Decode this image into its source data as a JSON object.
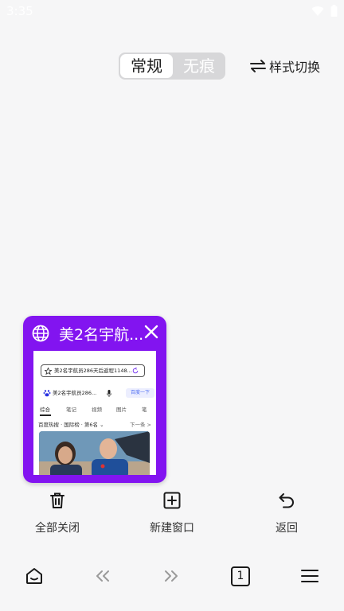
{
  "status_bar": {
    "time": "3:35"
  },
  "mode_switch": {
    "normal_label": "常规",
    "incognito_label": "无痕"
  },
  "style_switch": {
    "label": "样式切换"
  },
  "tab_card": {
    "title": "美2名宇航...",
    "accent_color": "#8214f0",
    "preview": {
      "search_box_text": "美2名宇航员286天后返程1148...",
      "query_text": "美2名宇航员286...",
      "search_button": "百度一下",
      "tabs": [
        "综合",
        "笔记",
        "视频",
        "图片",
        "笔"
      ],
      "more": "下一条 >",
      "hot_text": "百度热搜 · 国际榜 · 第6名 ⌄"
    }
  },
  "actions": [
    {
      "label": "全部关闭",
      "icon": "trash-icon"
    },
    {
      "label": "新建窗口",
      "icon": "add-window-icon"
    },
    {
      "label": "返回",
      "icon": "undo-icon"
    }
  ],
  "bottom_nav": {
    "tab_count": "1"
  }
}
